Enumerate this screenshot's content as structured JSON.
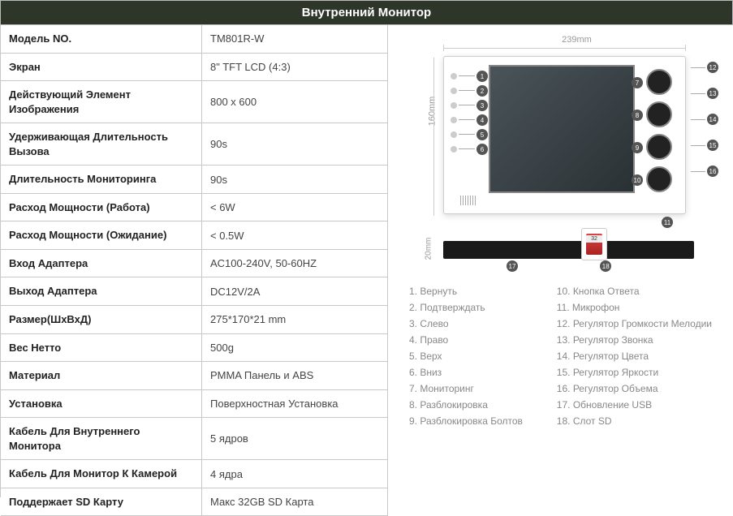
{
  "header": "Внутренний Монитор",
  "specs": [
    {
      "label": "Модель NO.",
      "value": "TM801R-W"
    },
    {
      "label": "Экран",
      "value": "8\" TFT LCD (4:3)"
    },
    {
      "label": "Действующий Элемент Изображения",
      "value": "800 x 600"
    },
    {
      "label": "Удерживающая Длительность Вызова",
      "value": "90s"
    },
    {
      "label": "Длительность Мониторинга",
      "value": "90s"
    },
    {
      "label": "Расход Мощности (Работа)",
      "value": "< 6W"
    },
    {
      "label": "Расход Мощности (Ожидание)",
      "value": "< 0.5W"
    },
    {
      "label": "Вход Адаптера",
      "value": "AC100-240V, 50-60HZ"
    },
    {
      "label": "Выход Адаптера",
      "value": "DC12V/2A"
    },
    {
      "label": "Размер(ШхВхД)",
      "value": "275*170*21 mm"
    },
    {
      "label": "Вес Нетто",
      "value": "500g"
    },
    {
      "label": "Материал",
      "value": "PMMA Панель и ABS"
    },
    {
      "label": "Установка",
      "value": "Поверхностная Установка"
    },
    {
      "label": "Кабель Для Внутреннего Монитора",
      "value": "5 ядров"
    },
    {
      "label": "Кабель Для Монитор К Камерой",
      "value": "4 ядра"
    },
    {
      "label": "Поддержает SD Карту",
      "value": "Макс 32GB SD Карта"
    }
  ],
  "dims": {
    "width": "239mm",
    "height": "160mm",
    "depth": "20mm"
  },
  "legend1": [
    {
      "n": "1",
      "t": "Вернуть"
    },
    {
      "n": "2",
      "t": "Подтверждать"
    },
    {
      "n": "3",
      "t": "Слево"
    },
    {
      "n": "4",
      "t": "Право"
    },
    {
      "n": "5",
      "t": "Верх"
    },
    {
      "n": "6",
      "t": "Вниз"
    },
    {
      "n": "7",
      "t": "Мониторинг"
    },
    {
      "n": "8",
      "t": "Разблокировка"
    },
    {
      "n": "9",
      "t": "Разблокировка Болтов"
    }
  ],
  "legend2": [
    {
      "n": "10",
      "t": "Кнопка Ответа"
    },
    {
      "n": "11",
      "t": "Микрофон"
    },
    {
      "n": "12",
      "t": "Регулятор Громкости Мелодии"
    },
    {
      "n": "13",
      "t": "Регулятор Звонка"
    },
    {
      "n": "14",
      "t": "Регулятор Цвета"
    },
    {
      "n": "15",
      "t": "Регулятор Яркости"
    },
    {
      "n": "16",
      "t": "Регулятор Объема"
    },
    {
      "n": "17",
      "t": "Обновление USB"
    },
    {
      "n": "18",
      "t": "Слот SD"
    }
  ]
}
